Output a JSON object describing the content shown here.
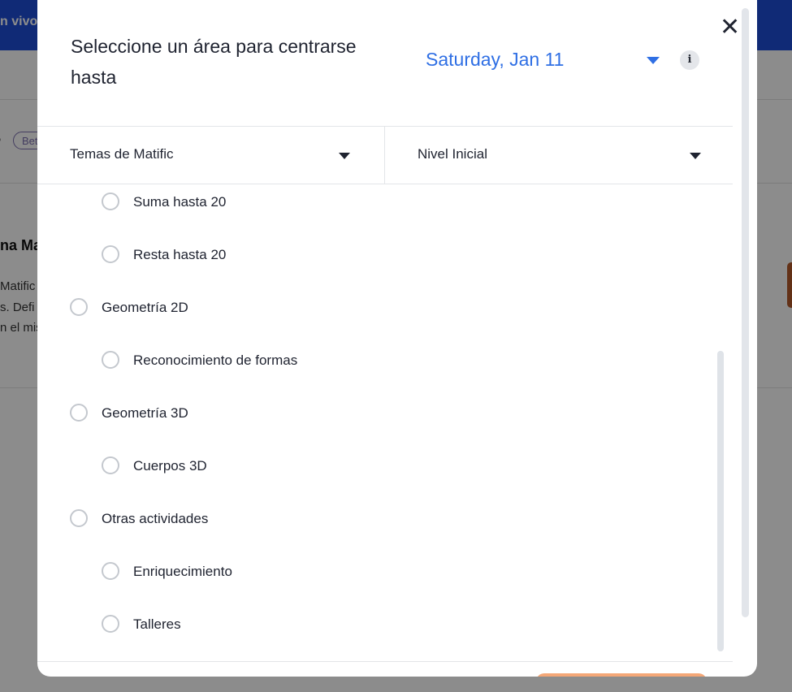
{
  "background": {
    "topbar_text": "n vivo",
    "badge_label": "Bet",
    "title_fragment": "na Ma",
    "text_lines": [
      "Matific",
      "s. Defi",
      "n el mis"
    ]
  },
  "modal": {
    "title": "Seleccione un área para centrarse hasta",
    "date_value": "Saturday, Jan 11",
    "info_icon_glyph": "i",
    "close_icon_glyph": "✕"
  },
  "filters": {
    "topic": "Temas de Matific",
    "level": "Nivel Inicial"
  },
  "options": [
    {
      "label": "Suma hasta 20",
      "level": 2
    },
    {
      "label": "Resta hasta 20",
      "level": 2
    },
    {
      "label": "Geometría 2D",
      "level": 1
    },
    {
      "label": "Reconocimiento de formas",
      "level": 2
    },
    {
      "label": "Geometría 3D",
      "level": 1
    },
    {
      "label": "Cuerpos 3D",
      "level": 2
    },
    {
      "label": "Otras actividades",
      "level": 1
    },
    {
      "label": "Enriquecimiento",
      "level": 2
    },
    {
      "label": "Talleres",
      "level": 2
    }
  ],
  "colors": {
    "accent": "#2f6fe4",
    "topbar": "#1e4ed8",
    "primary_button": "#f4a777"
  }
}
